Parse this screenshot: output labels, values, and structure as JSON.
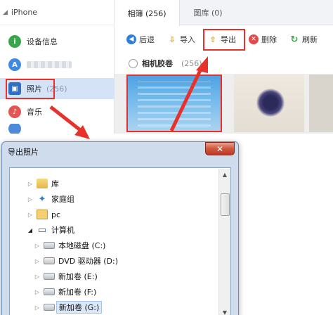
{
  "sidebar": {
    "device_label": "iPhone",
    "items": [
      {
        "label": "设备信息",
        "icon": "info-icon"
      },
      {
        "label": "",
        "icon": "app-store-icon"
      },
      {
        "label": "照片",
        "count": "(256)",
        "icon": "photo-icon"
      },
      {
        "label": "音乐",
        "icon": "music-icon"
      }
    ]
  },
  "tabs": [
    {
      "label": "相簿 (256)"
    },
    {
      "label": "图库 (0)"
    }
  ],
  "toolbar": {
    "back": "后退",
    "import": "导入",
    "export": "导出",
    "delete": "删除",
    "refresh": "刷新"
  },
  "album": {
    "label": "相机胶卷",
    "count": "(256)"
  },
  "dialog": {
    "title": "导出照片",
    "close_symbol": "✕",
    "tree": [
      {
        "label": "库",
        "icon": "library-folder-icon",
        "expander": "▷"
      },
      {
        "label": "家庭组",
        "icon": "homegroup-icon",
        "expander": "▷"
      },
      {
        "label": "pc",
        "icon": "user-folder-icon",
        "expander": "▷"
      },
      {
        "label": "计算机",
        "icon": "computer-icon",
        "expander": "◢"
      },
      {
        "label": "本地磁盘 (C:)",
        "icon": "hard-disk-icon",
        "expander": "▷"
      },
      {
        "label": "DVD 驱动器 (D:)",
        "icon": "dvd-drive-icon",
        "expander": "▷"
      },
      {
        "label": "新加卷 (E:)",
        "icon": "hard-disk-icon",
        "expander": "▷"
      },
      {
        "label": "新加卷 (F:)",
        "icon": "hard-disk-icon",
        "expander": "▷"
      },
      {
        "label": "新加卷 (G:)",
        "icon": "hard-disk-icon",
        "expander": "▷"
      }
    ]
  },
  "colors": {
    "highlight": "#e8312b",
    "selection": "#d5e3f7"
  }
}
